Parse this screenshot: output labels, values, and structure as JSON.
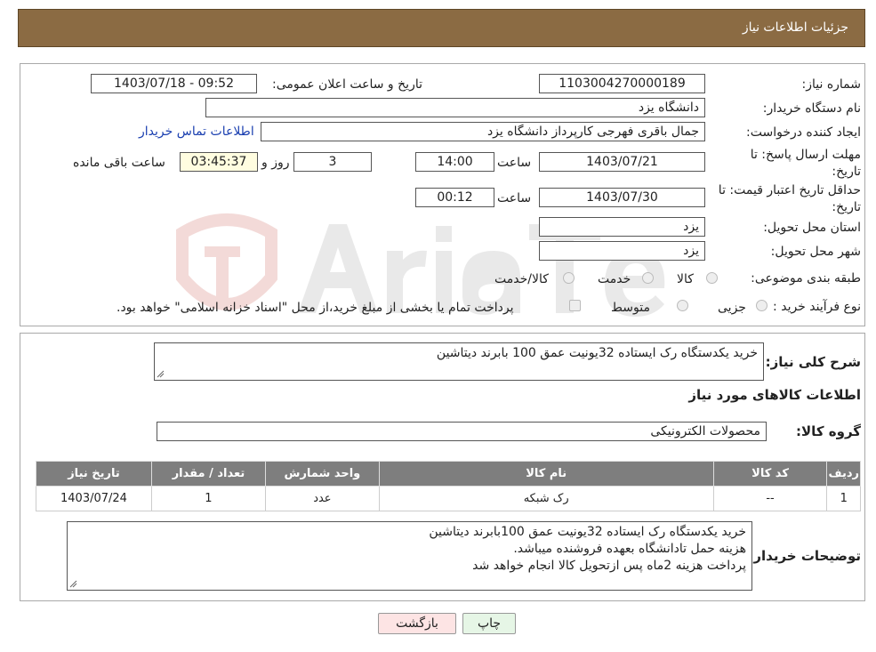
{
  "header": {
    "title": "جزئیات اطلاعات نیاز"
  },
  "form": {
    "need_number_label": "شماره نیاز:",
    "need_number": "1103004270000189",
    "announce_label": "تاریخ و ساعت اعلان عمومی:",
    "announce_value": "1403/07/18 - 09:52",
    "buyer_org_label": "نام دستگاه خریدار:",
    "buyer_org": "دانشگاه یزد",
    "creator_label": "ایجاد کننده درخواست:",
    "creator": "جمال باقری فهرجی کارپرداز دانشگاه یزد",
    "contact_link": "اطلاعات تماس خریدار",
    "deadline_label": "مهلت ارسال پاسخ: تا تاریخ:",
    "deadline_date": "1403/07/21",
    "time_word": "ساعت",
    "deadline_time": "14:00",
    "days": "3",
    "days_word": "روز و",
    "remaining": "03:45:37",
    "remaining_word": "ساعت باقی مانده",
    "price_validity_label": "حداقل تاریخ اعتبار قیمت: تا تاریخ:",
    "price_validity_date": "1403/07/30",
    "price_validity_time": "00:12",
    "province_label": "استان محل تحویل:",
    "province": "یزد",
    "city_label": "شهر محل تحویل:",
    "city": "یزد",
    "category_label": "طبقه بندی موضوعی:",
    "category_options": [
      "کالا",
      "خدمت",
      "کالا/خدمت"
    ],
    "purchase_label": "نوع فرآیند خرید :",
    "purchase_options": [
      "جزیی",
      "متوسط"
    ],
    "purchase_note": "پرداخت تمام یا بخشی از مبلغ خرید،از محل \"اسناد خزانه اسلامی\" خواهد بود."
  },
  "details": {
    "summary_label": "شرح کلی نیاز:",
    "summary": "خرید یکدستگاه رک ایستاده 32یونیت عمق 100 بابرند دیتاشین",
    "goods_info_title": "اطلاعات کالاهای مورد نیاز",
    "goods_group_label": "گروه کالا:",
    "goods_group": "محصولات الکترونیکی",
    "table": {
      "headers": [
        "ردیف",
        "کد کالا",
        "نام کالا",
        "واحد شمارش",
        "تعداد / مقدار",
        "تاریخ نیاز"
      ],
      "rows": [
        [
          "1",
          "--",
          "رک شبکه",
          "عدد",
          "1",
          "1403/07/24"
        ]
      ]
    },
    "buyer_notes_label": "توضیحات خریدار:",
    "buyer_notes": [
      "خرید یکدستگاه رک ایستاده 32یونیت عمق 100بابرند دیتاشین",
      "هزینه حمل تادانشگاه بعهده فروشنده میباشد.",
      "پرداخت هزینه 2ماه پس ازتحویل کالا انجام خواهد شد"
    ]
  },
  "buttons": {
    "print": "چاپ",
    "back": "بازگشت"
  },
  "colors": {
    "header_bg": "#8b6b43",
    "table_header_bg": "#7e7e7e",
    "back_btn_bg": "#fde4e4",
    "print_btn_bg": "#e6f6e6"
  }
}
